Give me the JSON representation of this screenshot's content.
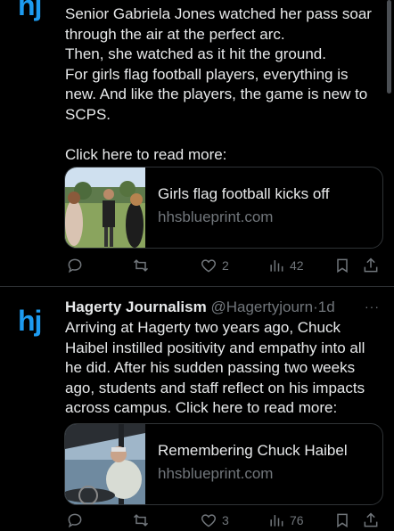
{
  "post1": {
    "avatar_text": "hj",
    "body": "Senior Gabriela Jones watched her pass soar\nthrough the air at the perfect arc.\nThen, she watched as it hit the ground.\nFor girls flag football players, everything is\nnew. And like the players, the game is new to\nSCPS.\n\nClick here to read more:",
    "card": {
      "title": "Girls flag football kicks off",
      "domain": "hhsblueprint.com"
    },
    "replies": "",
    "reposts": "",
    "likes": "2",
    "views": "42"
  },
  "post2": {
    "avatar_text": "hj",
    "author": "Hagerty Journalism",
    "handle": "@Hagertyjourn",
    "dot": "·",
    "time": "1d",
    "more": "···",
    "body": "Arriving at Hagerty two years ago, Chuck\nHaibel instilled positivity and empathy into all\nhe did. After his sudden passing two weeks\nago, students and staff reflect on his impacts\nacross campus. Click here to read more:",
    "card": {
      "title": "Remembering Chuck Haibel",
      "domain": "hhsblueprint.com"
    },
    "replies": "",
    "reposts": "",
    "likes": "3",
    "views": "76"
  },
  "colors": {
    "background": "#000000",
    "text": "#e7e9ea",
    "muted": "#71767b",
    "accent": "#1d9bf0",
    "border": "#2f3336"
  },
  "icons": [
    "reply-icon",
    "repost-icon",
    "like-icon",
    "views-icon",
    "bookmark-icon",
    "share-icon"
  ]
}
